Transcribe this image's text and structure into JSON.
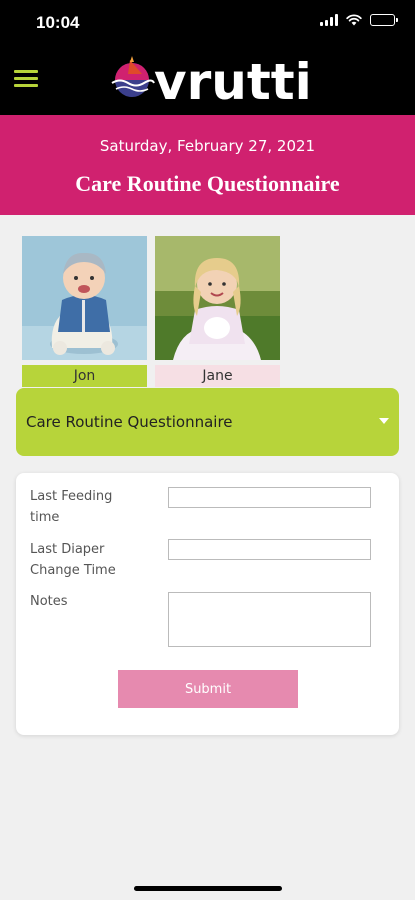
{
  "status_bar": {
    "time": "10:04",
    "icons": [
      "signal-icon",
      "wifi-icon",
      "battery-icon"
    ]
  },
  "header": {
    "menu_icon": "hamburger-menu-icon",
    "logo_text": "vrutti",
    "colors": {
      "background": "#000000",
      "accent": "#b7d43a"
    }
  },
  "banner": {
    "date": "Saturday, February 27, 2021",
    "title": "Care Routine Questionnaire",
    "background": "#d0216f"
  },
  "children": [
    {
      "name": "Jon",
      "selected": true,
      "label_color": "#b7d43a"
    },
    {
      "name": "Jane",
      "selected": false,
      "label_color": "#f6dfe4"
    }
  ],
  "dropdown": {
    "selected": "Care Routine Questionnaire",
    "icon": "caret-down-icon",
    "background": "#b7d43a"
  },
  "form": {
    "feeding_label": "Last Feeding time",
    "feeding_value": "",
    "diaper_label": "Last Diaper Change Time",
    "diaper_value": "",
    "notes_label": "Notes",
    "notes_value": "",
    "submit_label": "Submit",
    "submit_color": "#e68aaf"
  }
}
